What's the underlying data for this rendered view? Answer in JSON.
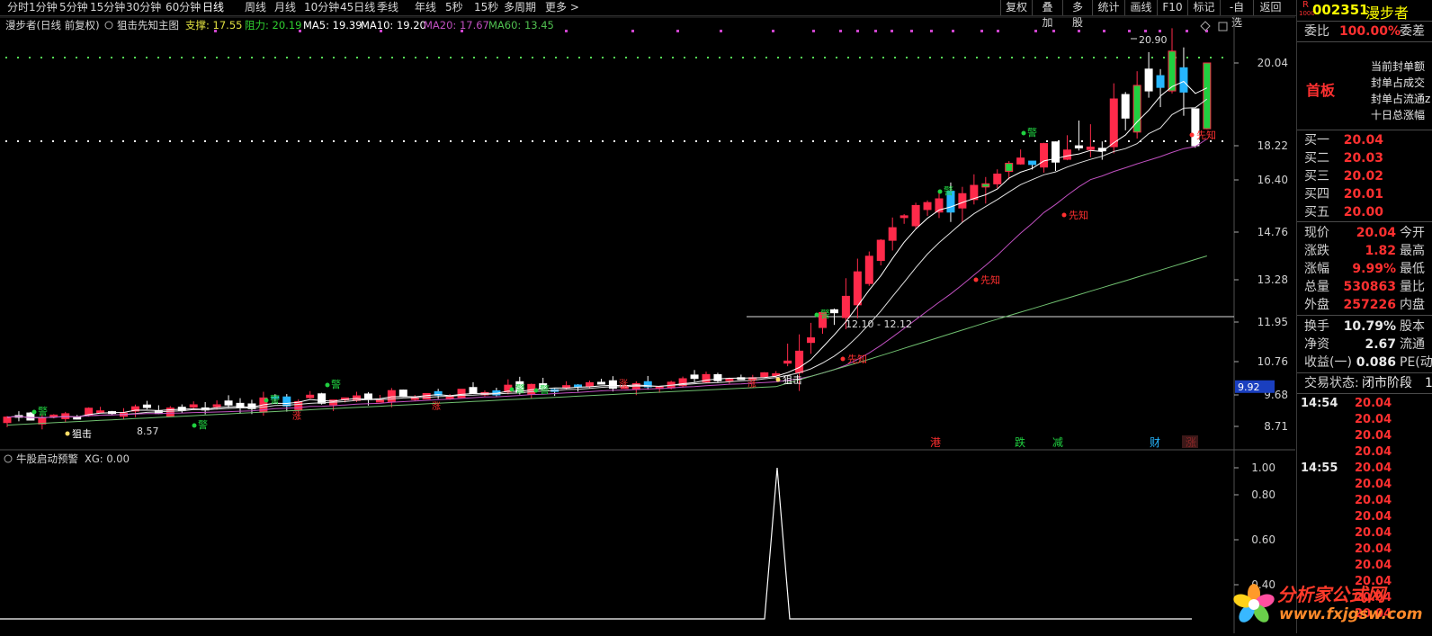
{
  "toolbar": {
    "periods": [
      "分时",
      "1分钟",
      "5分钟",
      "15分钟",
      "30分钟",
      "60分钟",
      "日线",
      "周线",
      "月线",
      "10分钟",
      "45日线",
      "季线",
      "年线",
      "5秒",
      "15秒",
      "多周期",
      "更多 >"
    ],
    "active_period": "日线",
    "right_buttons": [
      "复权",
      "叠加",
      "多股",
      "统计",
      "画线",
      "F10",
      "标记",
      "-自选",
      "返回"
    ]
  },
  "chart_header": {
    "stock": "漫步者(日线 前复权)",
    "formula": "狙击先知主图",
    "support_label": "支撑: 17.55",
    "resistance_label": "阻力: 20.19",
    "ma5": "MA5: 19.39",
    "ma10": "MA10: 19.20",
    "ma20": "MA20: 17.67",
    "ma60": "MA60: 13.45"
  },
  "colors": {
    "up": "#ff2a4a",
    "down": "#26b6ff",
    "signal_green": "#20d040",
    "ma5": "#ffffff",
    "ma10": "#e0e0e0",
    "ma20": "#c050c0",
    "ma60": "#70c070",
    "dots_green": "#55dd55",
    "dots_white": "#ffffff",
    "purple_marks": "#cc44cc",
    "axis_text": "#d0d0d0",
    "current_price_box": "#1a3fbf"
  },
  "price_axis": [
    "20.04",
    "18.22",
    "16.40",
    "14.76",
    "13.28",
    "11.95",
    "10.76",
    "9.68",
    "8.71"
  ],
  "current_price_tag": "9.92",
  "annotations": {
    "high_label": "20.90",
    "range_label": "12.10 - 12.12",
    "low_label": "8.57",
    "warn": "警",
    "foreknow": "先知",
    "snipe": "狙击",
    "rise": "涨",
    "event_labels": [
      "港",
      "跌",
      "减",
      "财",
      "涨"
    ]
  },
  "sub_chart": {
    "title": "牛股启动预警",
    "xg_label": "XG: 0.00",
    "axis": [
      "1.00",
      "0.80",
      "0.60",
      "0.40"
    ]
  },
  "right_panel": {
    "code_prefix": "R",
    "code_sub": "1000",
    "code": "002351",
    "name": "漫步者",
    "wb_label": "委比",
    "wb_value": "100.00%",
    "wc_label": "委差",
    "limit_status": "首板",
    "limit_info": [
      "当前封单额",
      "封单占成交",
      "封单占流通z",
      "十日总涨幅"
    ],
    "bids": [
      {
        "label": "买一",
        "price": "20.04"
      },
      {
        "label": "买二",
        "price": "20.03"
      },
      {
        "label": "买三",
        "price": "20.02"
      },
      {
        "label": "买四",
        "price": "20.01"
      },
      {
        "label": "买五",
        "price": "20.00"
      }
    ],
    "quote": [
      {
        "label": "现价",
        "value": "20.04",
        "label2": "今开"
      },
      {
        "label": "涨跌",
        "value": "1.82",
        "label2": "最高"
      },
      {
        "label": "涨幅",
        "value": "9.99%",
        "label2": "最低"
      },
      {
        "label": "总量",
        "value": "530863",
        "label2": "量比"
      },
      {
        "label": "外盘",
        "value": "257226",
        "label2": "内盘"
      }
    ],
    "fin": [
      {
        "label": "换手",
        "value": "10.79%",
        "label2": "股本"
      },
      {
        "label": "净资",
        "value": "2.67",
        "label2": "流通"
      },
      {
        "label": "收益(一)",
        "value": "0.086",
        "label2": "PE(动"
      }
    ],
    "trade_status_label": "交易状态:",
    "trade_status_value": "闭市阶段",
    "trade_status_num": "1",
    "ticks": [
      {
        "time": "14:54",
        "price": "20.04"
      },
      {
        "time": "",
        "price": "20.04"
      },
      {
        "time": "",
        "price": "20.04"
      },
      {
        "time": "",
        "price": "20.04"
      },
      {
        "time": "14:55",
        "price": "20.04"
      },
      {
        "time": "",
        "price": "20.04"
      },
      {
        "time": "",
        "price": "20.04"
      },
      {
        "time": "",
        "price": "20.04"
      },
      {
        "time": "",
        "price": "20.04"
      },
      {
        "time": "",
        "price": "20.04"
      },
      {
        "time": "",
        "price": "20.04"
      },
      {
        "time": "",
        "price": "20.04"
      },
      {
        "time": "",
        "price": "20.04"
      },
      {
        "time": "",
        "price": "20.04"
      }
    ]
  },
  "watermark": {
    "text": "分析家公式网",
    "url": "www.fxjgsw.com"
  }
}
